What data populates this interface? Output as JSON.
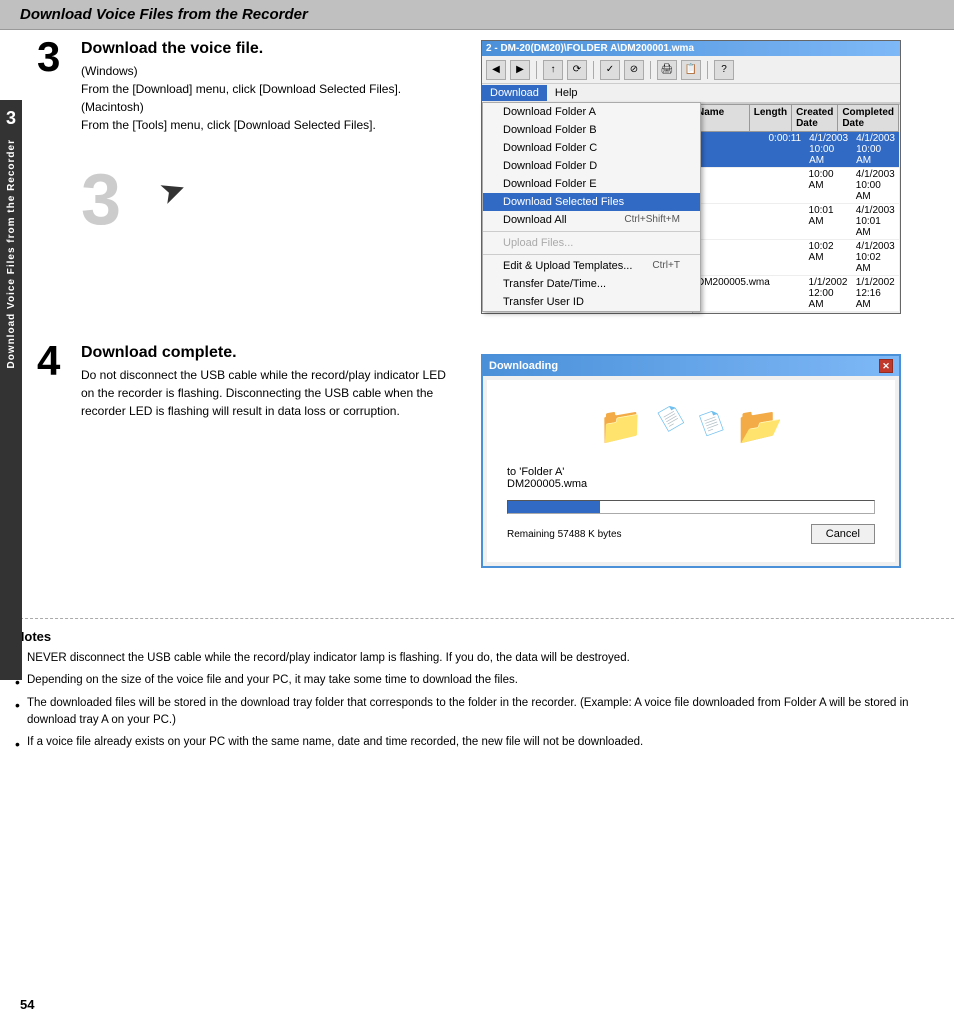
{
  "page": {
    "header": "Download Voice Files from the Recorder",
    "page_number": "54"
  },
  "side_tab": {
    "number": "3",
    "text": "Download Voice Files from the Recorder"
  },
  "step3": {
    "number": "3",
    "title": "Download the voice file.",
    "body_lines": [
      "(Windows)",
      "From the [Download] menu, click [Download Selected Files].",
      "(Macintosh)",
      "From the [Tools] menu, click [Download Selected Files]."
    ]
  },
  "step4": {
    "number": "4",
    "title": "Download complete.",
    "body": "Do not disconnect the USB cable while the record/play indicator LED on the recorder is flashing. Disconnecting the USB cable when the recorder LED is flashing will result in data loss or corruption."
  },
  "screenshot1": {
    "title_bar": "2 - DM-20(DM20)\\FOLDER A\\DM200001.wma",
    "menu_bar": [
      "Download",
      "Help"
    ],
    "active_menu": "Download",
    "dropdown_items": [
      {
        "label": "Download Folder A",
        "shortcut": "",
        "disabled": false,
        "highlighted": false
      },
      {
        "label": "Download Folder B",
        "shortcut": "",
        "disabled": false,
        "highlighted": false
      },
      {
        "label": "Download Folder C",
        "shortcut": "",
        "disabled": false,
        "highlighted": false
      },
      {
        "label": "Download Folder D",
        "shortcut": "",
        "disabled": false,
        "highlighted": false
      },
      {
        "label": "Download Folder E",
        "shortcut": "",
        "disabled": false,
        "highlighted": false
      },
      {
        "label": "Download Selected Files",
        "shortcut": "",
        "disabled": false,
        "highlighted": true
      },
      {
        "label": "Download All",
        "shortcut": "Ctrl+Shift+M",
        "disabled": false,
        "highlighted": false
      },
      {
        "separator": true
      },
      {
        "label": "Upload Files...",
        "shortcut": "",
        "disabled": true,
        "highlighted": false
      },
      {
        "separator": true
      },
      {
        "label": "Edit & Upload Templates...",
        "shortcut": "Ctrl+T",
        "disabled": false,
        "highlighted": false
      },
      {
        "label": "Transfer Date/Time...",
        "shortcut": "",
        "disabled": false,
        "highlighted": false
      },
      {
        "label": "Transfer User ID",
        "shortcut": "",
        "disabled": false,
        "highlighted": false
      }
    ],
    "file_list": {
      "headers": [
        "Name",
        "Length",
        "Created Date",
        "Completed Date"
      ],
      "rows": [
        {
          "name": "",
          "length": "0:00:11",
          "created": "4/1/2003 10:00 AM",
          "completed": "4/1/2003 10:00 AM",
          "selected": true
        },
        {
          "name": "",
          "length": "",
          "created": "10:00 AM",
          "completed": "4/1/2003 10:00 AM",
          "selected": false
        },
        {
          "name": "",
          "length": "",
          "created": "10:01 AM",
          "completed": "4/1/2003 10:01 AM",
          "selected": false
        },
        {
          "name": "",
          "length": "",
          "created": "10:02 AM",
          "completed": "4/1/2003 10:02 AM",
          "selected": false
        },
        {
          "name": "DM200005.wma",
          "length": "",
          "created": "1/1/2002 12:00 AM",
          "completed": "1/1/2002 12:16 AM",
          "selected": false
        }
      ]
    }
  },
  "screenshot2": {
    "dialog_title": "Downloading",
    "destination": "to 'Folder A'",
    "filename": "DM200005.wma",
    "remaining": "Remaining 57488 K bytes",
    "cancel_label": "Cancel",
    "progress_percent": 25
  },
  "notes": {
    "title": "Notes",
    "items": [
      "NEVER disconnect the USB cable while the record/play indicator lamp is flashing. If you do, the data will be destroyed.",
      "Depending on the size of the voice file and your PC, it may take some time to download the files.",
      "The downloaded files will be stored in the download tray folder that corresponds to the folder in the recorder. (Example: A voice file downloaded from Folder A will be stored in download tray A on your PC.)",
      "If a voice file already exists on your PC with the same name, date and time recorded, the new file will not be downloaded."
    ]
  }
}
